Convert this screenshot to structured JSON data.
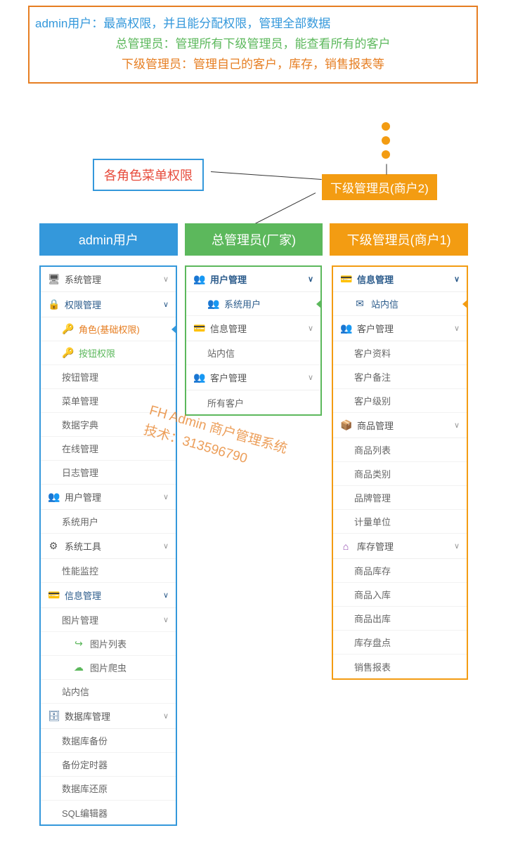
{
  "description": {
    "line1": "admin用户：最高权限，并且能分配权限，管理全部数据",
    "line2": "总管理员：管理所有下级管理员，能查看所有的客户",
    "line3": "下级管理员：管理自己的客户，库存，销售报表等"
  },
  "roles_label": "各角色菜单权限",
  "role_tab_merchant2": "下级管理员(商户2)",
  "columns": {
    "admin": {
      "title": "admin用户"
    },
    "manager": {
      "title": "总管理员(厂家)"
    },
    "sub": {
      "title": "下级管理员(商户1)"
    }
  },
  "menu_admin": {
    "g1": "系统管理",
    "g2": "权限管理",
    "g2_1": "角色(基础权限)",
    "g2_2": "按钮权限",
    "i_btn": "按钮管理",
    "i_menu": "菜单管理",
    "i_dict": "数据字典",
    "i_online": "在线管理",
    "i_log": "日志管理",
    "g3": "用户管理",
    "g3_1": "系统用户",
    "g4": "系统工具",
    "g4_1": "性能监控",
    "g5": "信息管理",
    "g5_1": "图片管理",
    "g5_1a": "图片列表",
    "g5_1b": "图片爬虫",
    "g5_2": "站内信",
    "g6": "数据库管理",
    "g6_1": "数据库备份",
    "g6_2": "备份定时器",
    "g6_3": "数据库还原",
    "g6_4": "SQL编辑器"
  },
  "menu_manager": {
    "g1": "用户管理",
    "g1_1": "系统用户",
    "g2": "信息管理",
    "g2_1": "站内信",
    "g3": "客户管理",
    "g3_1": "所有客户"
  },
  "menu_sub": {
    "g1": "信息管理",
    "g1_1": "站内信",
    "g2": "客户管理",
    "g2_1": "客户资料",
    "g2_2": "客户备注",
    "g2_3": "客户级别",
    "g3": "商品管理",
    "g3_1": "商品列表",
    "g3_2": "商品类别",
    "g3_3": "品牌管理",
    "g3_4": "计量单位",
    "g4": "库存管理",
    "g4_1": "商品库存",
    "g4_2": "商品入库",
    "g4_3": "商品出库",
    "g4_4": "库存盘点",
    "g4_5": "销售报表"
  },
  "watermark": {
    "l1": "FH Admin 商户管理系统",
    "l2": "技术：313596790"
  }
}
